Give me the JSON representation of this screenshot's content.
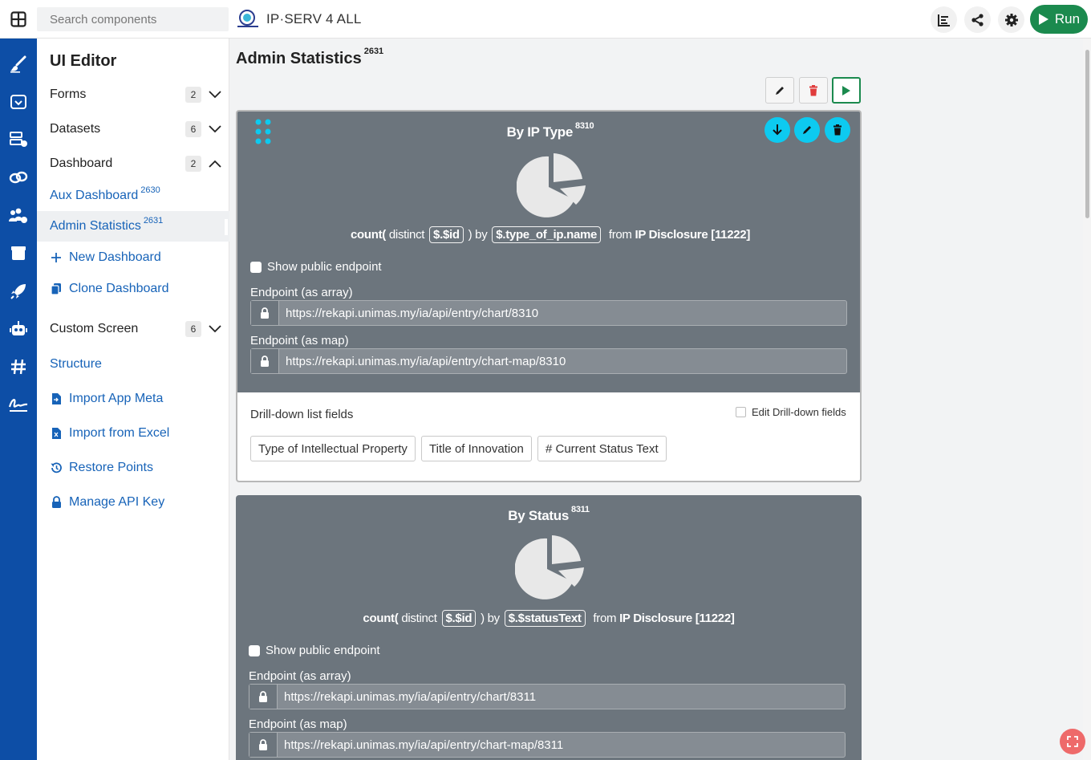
{
  "topbar": {
    "search_placeholder": "Search components",
    "app_title": "IP·SERV 4 ALL",
    "run_label": "Run"
  },
  "sidebar": {
    "title": "UI Editor",
    "groups": [
      {
        "label": "Forms",
        "count": "2"
      },
      {
        "label": "Datasets",
        "count": "6"
      },
      {
        "label": "Dashboard",
        "count": "2"
      },
      {
        "label": "Custom Screen",
        "count": "6"
      }
    ],
    "dashboards": [
      {
        "label": "Aux Dashboard",
        "id": "2630"
      },
      {
        "label": "Admin Statistics",
        "id": "2631"
      }
    ],
    "new_dashboard": "New Dashboard",
    "clone_dashboard": "Clone Dashboard",
    "structure": "Structure",
    "import_meta": "Import App Meta",
    "import_excel": "Import from Excel",
    "restore_points": "Restore Points",
    "manage_api": "Manage API Key"
  },
  "page": {
    "title": "Admin Statistics",
    "id": "2631"
  },
  "cards": [
    {
      "title": "By IP Type",
      "id": "8310",
      "query": {
        "fn": "count(",
        "distinct": "distinct",
        "field": "$.$id",
        "by": ") by",
        "group": "$.type_of_ip.name",
        "from": "from",
        "source": "IP Disclosure [11222]"
      },
      "public_label": "Show public endpoint",
      "endpoint_array_label": "Endpoint (as array)",
      "endpoint_array": "https://rekapi.unimas.my/ia/api/entry/chart/8310",
      "endpoint_map_label": "Endpoint (as map)",
      "endpoint_map": "https://rekapi.unimas.my/ia/api/entry/chart-map/8310",
      "drill_title": "Drill-down list fields",
      "drill_edit": "Edit Drill-down fields",
      "drill_fields": [
        "Type of Intellectual Property",
        "Title of Innovation",
        "# Current Status Text"
      ]
    },
    {
      "title": "By Status",
      "id": "8311",
      "query": {
        "fn": "count(",
        "distinct": "distinct",
        "field": "$.$id",
        "by": ") by",
        "group": "$.$statusText",
        "from": "from",
        "source": "IP Disclosure [11222]"
      },
      "public_label": "Show public endpoint",
      "endpoint_array_label": "Endpoint (as array)",
      "endpoint_array": "https://rekapi.unimas.my/ia/api/entry/chart/8311",
      "endpoint_map_label": "Endpoint (as map)",
      "endpoint_map": "https://rekapi.unimas.my/ia/api/entry/chart-map/8311"
    }
  ],
  "colors": {
    "rail": "#0d4ea6",
    "run": "#1b8a4e",
    "card": "#6c757d",
    "action": "#0dcaf0",
    "link": "#1763b8",
    "delete": "#e03c3c"
  }
}
